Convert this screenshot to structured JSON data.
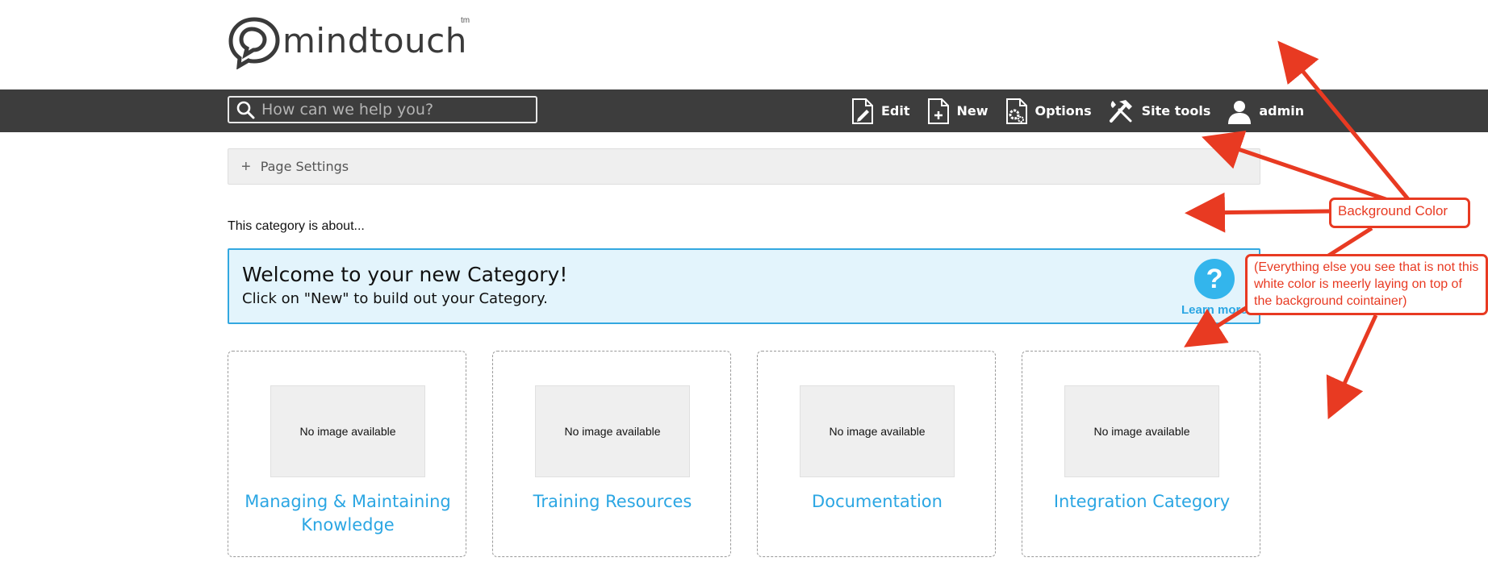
{
  "logo": {
    "text": "mindtouch",
    "tm": "tm"
  },
  "search": {
    "placeholder": "How can we help you?"
  },
  "nav": {
    "edit_label": "Edit",
    "new_label": "New",
    "options_label": "Options",
    "site_tools_label": "Site tools",
    "user_label": "admin"
  },
  "page_settings": {
    "label": "Page Settings"
  },
  "category_about": "This category is about...",
  "welcome": {
    "title": "Welcome to your new Category!",
    "subtitle": "Click on \"New\" to build out your Category.",
    "help_glyph": "?",
    "learn_more": "Learn more"
  },
  "cards": [
    {
      "image_text": "No image available",
      "title": "Managing & Maintaining Knowledge"
    },
    {
      "image_text": "No image available",
      "title": "Training Resources"
    },
    {
      "image_text": "No image available",
      "title": "Documentation"
    },
    {
      "image_text": "No image available",
      "title": "Integration Category"
    }
  ],
  "annotations": {
    "background_color": "Background Color",
    "note": "(Everything else you see that is not this white color is meerly laying on top of the background cointainer)"
  },
  "colors": {
    "navbar": "#3d3d3d",
    "accent_blue": "#2ba6e3",
    "banner_bg": "#e3f4fc",
    "annotation_red": "#e83a22"
  }
}
